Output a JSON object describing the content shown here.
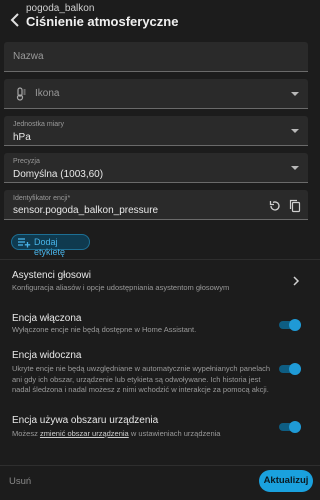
{
  "header": {
    "subtitle": "pogoda_balkon",
    "title": "Ciśnienie atmosferyczne"
  },
  "fields": {
    "name": {
      "placeholder": "Nazwa"
    },
    "icon": {
      "placeholder": "Ikona"
    },
    "unit": {
      "label": "Jednostka miary",
      "value": "hPa"
    },
    "precision": {
      "label": "Precyzja",
      "value": "Domyślna (1003,60)"
    },
    "entity_id": {
      "label": "Identyfikator encji*",
      "value": "sensor.pogoda_balkon_pressure"
    }
  },
  "chip": {
    "label": "Dodaj etykietę"
  },
  "voice": {
    "title": "Asystenci głosowi",
    "desc": "Konfiguracja aliasów i opcje udostępniania asystentom głosowym"
  },
  "enabled": {
    "title": "Encja włączona",
    "desc": "Wyłączone encje nie będą dostępne w Home Assistant.",
    "value": true
  },
  "visible": {
    "title": "Encja widoczna",
    "desc": "Ukryte encje nie będą uwzględniane w automatycznie wypełnianych panelach ani gdy ich obszar, urządzenie lub etykieta są odwoływane. Ich historia jest nadal śledzona i nadal możesz z nimi wchodzić w interakcje za pomocą akcji.",
    "value": true
  },
  "area": {
    "title": "Encja używa obszaru urządzenia",
    "desc_prefix": "Możesz ",
    "desc_link": "zmienić obszar urządzenia",
    "desc_suffix": " w ustawieniach urządzenia",
    "value": true
  },
  "footer": {
    "delete_label": "Usuń",
    "update_label": "Aktualizuj"
  },
  "colors": {
    "accent": "#1aa1de",
    "background": "#1c1c1c",
    "field_bg": "#2a2a2a"
  }
}
